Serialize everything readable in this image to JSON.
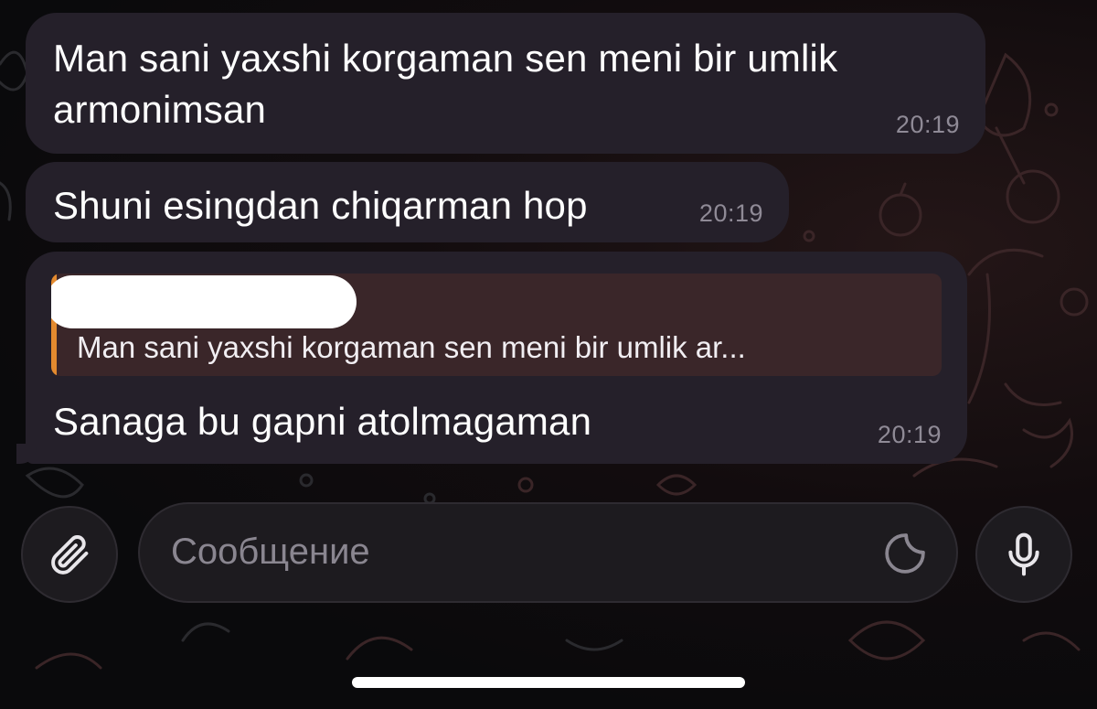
{
  "messages": [
    {
      "text": "Man sani yaxshi korgaman sen meni bir umlik armonimsan",
      "time": "20:19"
    },
    {
      "text": "Shuni esingdan chiqarman hop",
      "time": "20:19"
    },
    {
      "reply": {
        "author_redacted": true,
        "quoted_text": "Man sani yaxshi korgaman sen meni bir umlik ar..."
      },
      "text": "Sanaga bu gapni atolmagaman",
      "time": "20:19"
    }
  ],
  "composer": {
    "placeholder": "Сообщение",
    "attach_icon": "paperclip-icon",
    "sticker_icon": "sticker-icon",
    "mic_icon": "microphone-icon"
  },
  "colors": {
    "bubble": "#25202a",
    "reply_accent": "#e38a2f",
    "timestamp": "#8f8a96"
  }
}
